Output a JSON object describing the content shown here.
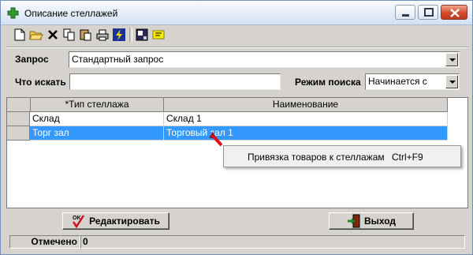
{
  "window": {
    "title": "Описание стеллажей"
  },
  "toolbar": {
    "icons": [
      "new-document-icon",
      "open-folder-icon",
      "delete-icon",
      "copy-icon",
      "paste-icon",
      "print-icon",
      "lightning-icon",
      "export-icon",
      "note-icon"
    ]
  },
  "query": {
    "label": "Запрос",
    "value": "Стандартный запрос"
  },
  "search": {
    "label": "Что искать",
    "value": ""
  },
  "search_mode": {
    "label": "Режим поиска",
    "value": "Начинается с"
  },
  "grid": {
    "columns": [
      "*Тип стеллажа",
      "Наименование"
    ],
    "rows": [
      {
        "type": "Склад",
        "name": "Склад 1"
      },
      {
        "type": "Торг зал",
        "name": "Торговый зал 1"
      }
    ],
    "selected_row": 1
  },
  "context_menu": {
    "item": "Привязка товаров к стеллажам",
    "shortcut": "Ctrl+F9"
  },
  "buttons": {
    "edit": "Редактировать",
    "exit": "Выход"
  },
  "status": {
    "label": "Отмечено",
    "value": "0"
  },
  "colors": {
    "selection": "#3399ff",
    "face": "#d6d3ce"
  }
}
